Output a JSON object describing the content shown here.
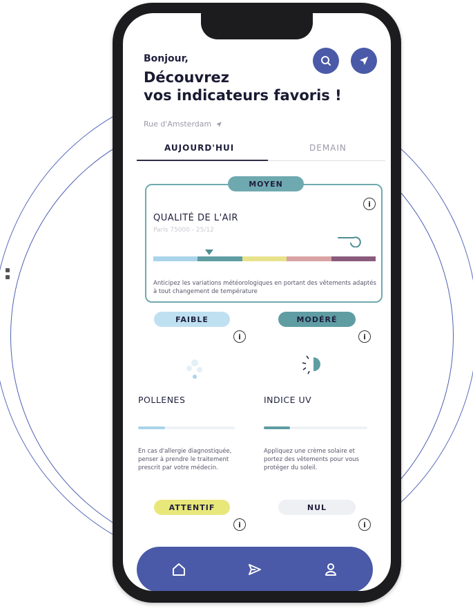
{
  "header": {
    "greeting": "Bonjour,",
    "title_line1": "Découvrez",
    "title_line2": "vos indicateurs favoris !",
    "location": "Rue d'Amsterdam"
  },
  "icons": {
    "search": "search-icon",
    "location": "location-arrow-icon",
    "info": "info-icon",
    "home": "home-icon",
    "send": "send-icon",
    "user": "user-icon"
  },
  "tabs": [
    {
      "label": "AUJOURD'HUI",
      "active": true
    },
    {
      "label": "DEMAIN",
      "active": false
    }
  ],
  "air_quality": {
    "badge": "MOYEN",
    "title": "QUALITÉ DE L'AIR",
    "subtitle": "Paris 75000 - 25/12",
    "level_fraction": 0.25,
    "scale_colors": [
      "#a9d4ea",
      "#5f9da3",
      "#e8e28c",
      "#d9a3a3",
      "#8a5a7a"
    ],
    "advice": "Anticipez les variations météorologiques en portant des vêtements adaptés à tout changement de température"
  },
  "indicators": [
    {
      "badge": "FAIBLE",
      "badge_color": "#bfe0f1",
      "title": "POLLENES",
      "level_fraction": 0.28,
      "bar_color": "#a9d4ea",
      "advice": "En cas d'allergie diagnostiquée, penser à prendre le traitement prescrit par votre médecin."
    },
    {
      "badge": "MODÉRÉ",
      "badge_color": "#5f9da3",
      "title": "INDICE UV",
      "level_fraction": 0.25,
      "bar_color": "#5f9da3",
      "advice": "Appliquez une crème solaire et portez des vêtements pour vous protéger du soleil."
    },
    {
      "badge": "ATTENTIF",
      "badge_color": "#e8e77a"
    },
    {
      "badge": "NUL",
      "badge_color": "#eef0f4"
    }
  ],
  "colors": {
    "accent": "#4a5aa8",
    "card_border": "#6fa9b0"
  }
}
